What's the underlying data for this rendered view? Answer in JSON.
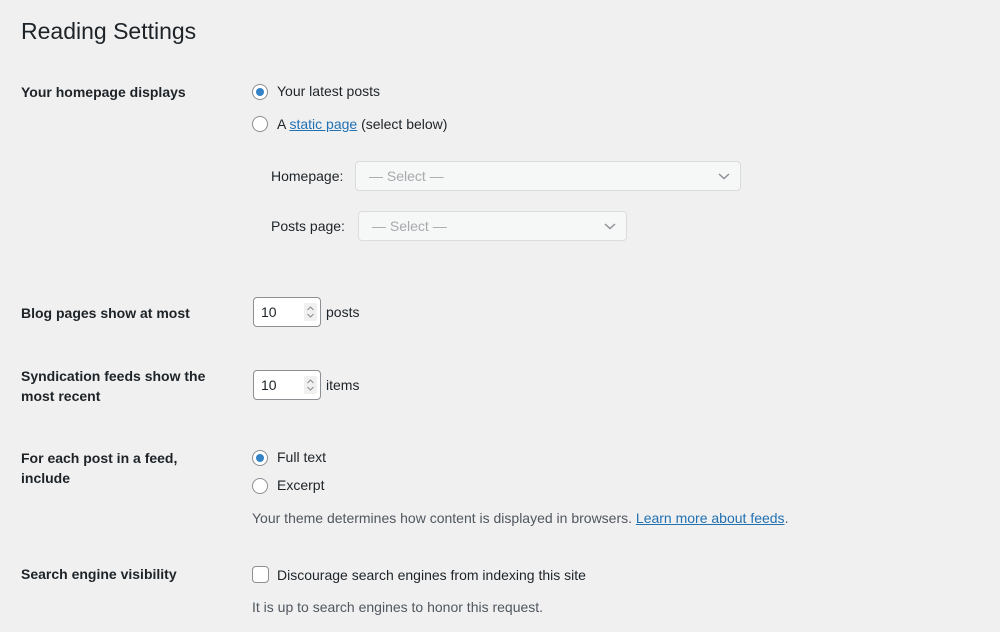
{
  "page": {
    "title": "Reading Settings"
  },
  "homepage_displays": {
    "label": "Your homepage displays",
    "options": [
      {
        "label": "Your latest posts",
        "checked": true
      },
      {
        "prefix": "A ",
        "link": "static page",
        "suffix": " (select below)",
        "checked": false
      }
    ],
    "homepage_select": {
      "label": "Homepage:",
      "value": "— Select —"
    },
    "posts_page_select": {
      "label": "Posts page:",
      "value": "— Select —"
    }
  },
  "blog_pages": {
    "label": "Blog pages show at most",
    "value": "10",
    "unit": "posts"
  },
  "syndication": {
    "label_line1": "Syndication feeds show the",
    "label_line2": "most recent",
    "value": "10",
    "unit": "items"
  },
  "feed_content": {
    "label_line1": "For each post in a feed,",
    "label_line2": "include",
    "options": [
      {
        "label": "Full text",
        "checked": true
      },
      {
        "label": "Excerpt",
        "checked": false
      }
    ],
    "description": "Your theme determines how content is displayed in browsers. ",
    "link": "Learn more about feeds",
    "link_suffix": "."
  },
  "search_visibility": {
    "label": "Search engine visibility",
    "checkbox_label": "Discourage search engines from indexing this site",
    "checked": false,
    "description": "It is up to search engines to honor this request."
  },
  "colors": {
    "accent": "#3582c4",
    "link": "#2271b1",
    "background": "#f0f0f1"
  }
}
